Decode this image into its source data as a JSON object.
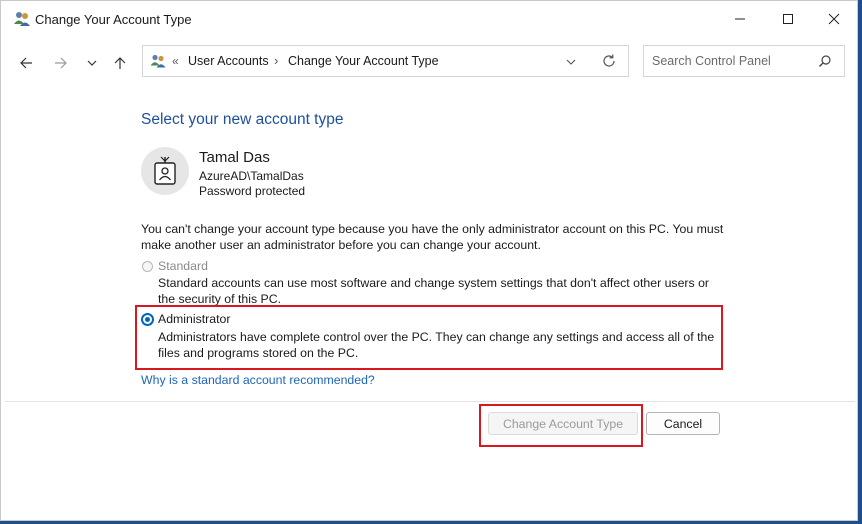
{
  "window": {
    "title": "Change Your Account Type"
  },
  "nav": {
    "back_icon": "arrow-left-icon",
    "forward_icon": "arrow-right-icon",
    "recent_icon": "chevron-down-icon",
    "up_icon": "arrow-up-icon"
  },
  "address": {
    "chevrons": "«",
    "crumbs": [
      "User Accounts",
      "Change Your Account Type"
    ],
    "separator": "›"
  },
  "search": {
    "placeholder": "Search Control Panel"
  },
  "content": {
    "heading": "Select your new account type",
    "user": {
      "name": "Tamal Das",
      "domain": "AzureAD\\TamalDas",
      "status": "Password protected"
    },
    "notice": "You can't change your account type because you have the only administrator account on this PC. You must make another user an administrator before you can change your account.",
    "options": [
      {
        "label": "Standard",
        "description": "Standard accounts can use most software and change system settings that don't affect other users or the security of this PC.",
        "selected": false,
        "enabled": false
      },
      {
        "label": "Administrator",
        "description": "Administrators have complete control over the PC. They can change any settings and access all of the files and programs stored on the PC.",
        "selected": true,
        "enabled": true
      }
    ],
    "link": "Why is a standard account recommended?"
  },
  "buttons": {
    "change": "Change Account Type",
    "cancel": "Cancel"
  },
  "colors": {
    "heading": "#1f4f9a",
    "link": "#1f66b6",
    "highlight": "#d7191f",
    "radio_accent": "#0067c0"
  }
}
